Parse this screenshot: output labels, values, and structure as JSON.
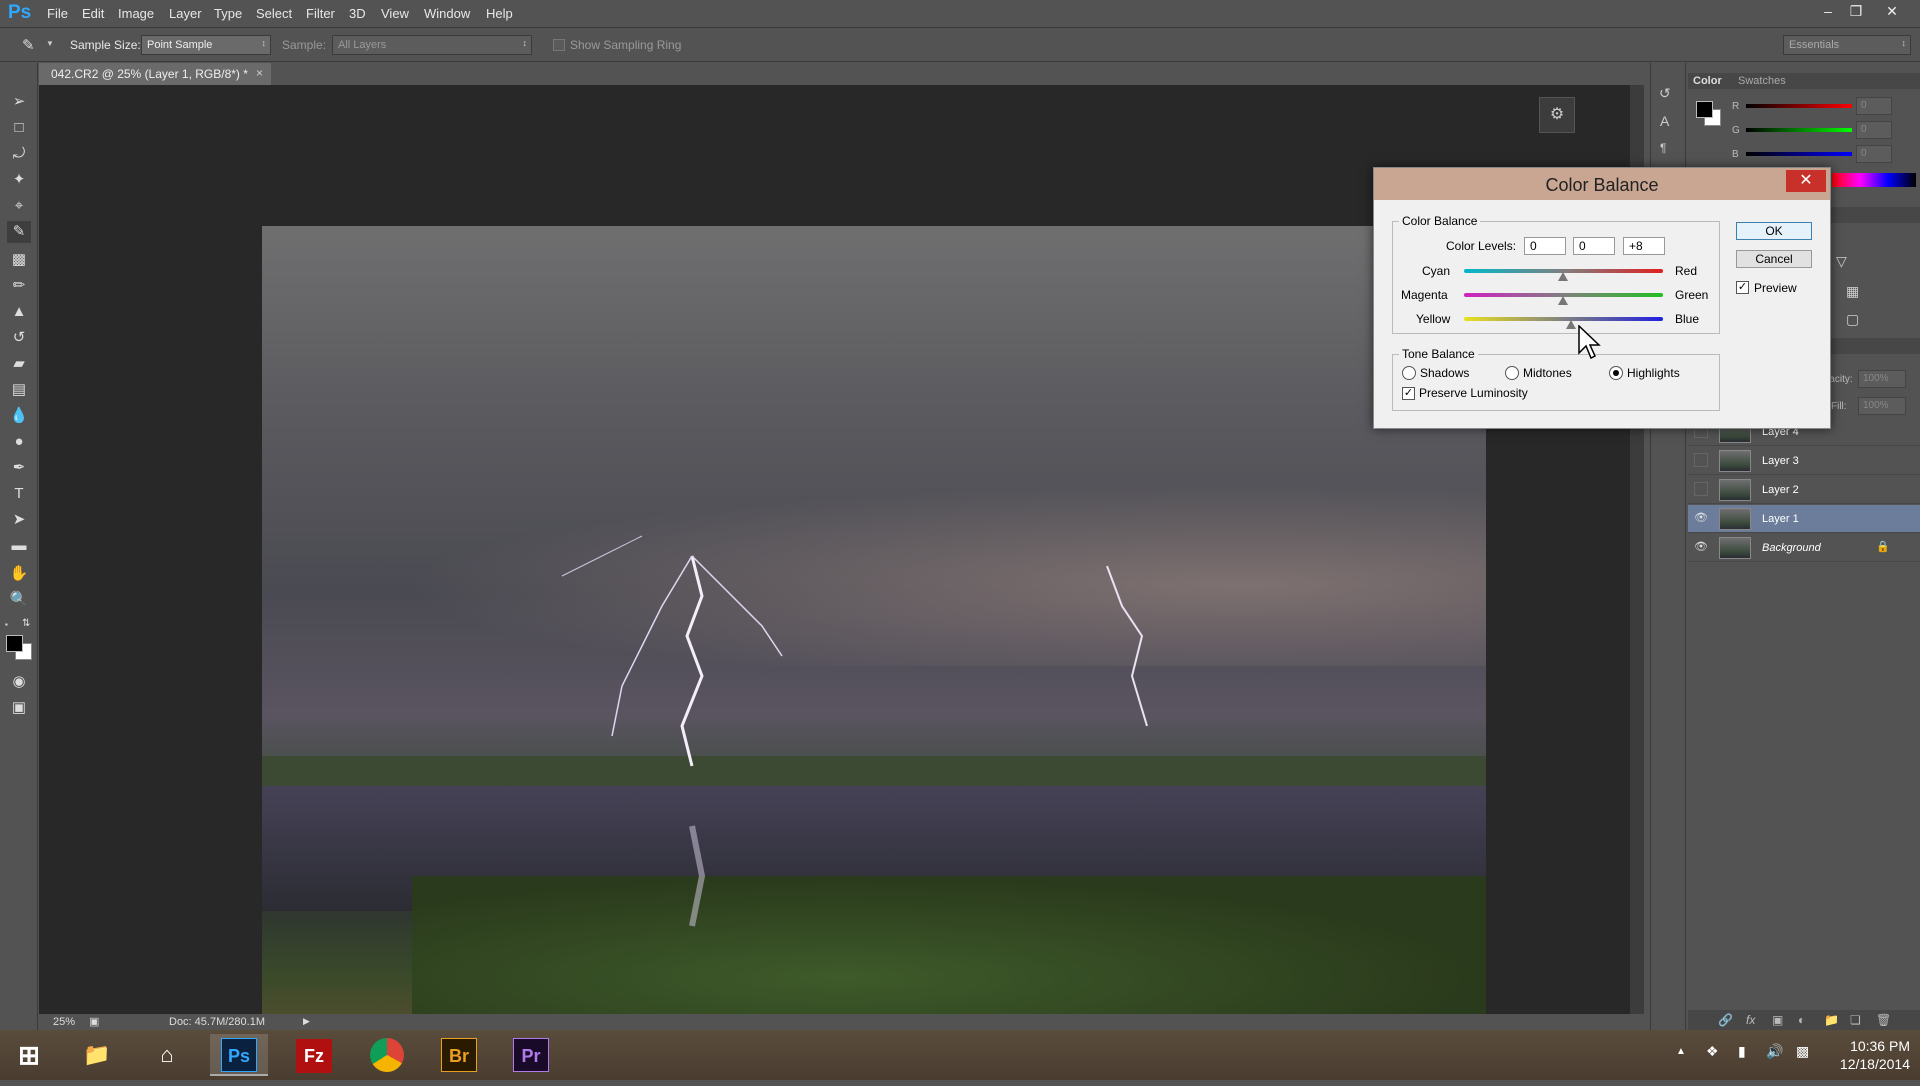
{
  "app": {
    "logo": "Ps"
  },
  "menu": [
    "File",
    "Edit",
    "Image",
    "Layer",
    "Type",
    "Select",
    "Filter",
    "3D",
    "View",
    "Window",
    "Help"
  ],
  "options": {
    "sample_size_label": "Sample Size:",
    "sample_size_value": "Point Sample",
    "sample_label": "Sample:",
    "sample_value": "All Layers",
    "sampling_ring_label": "Show Sampling Ring",
    "workspace": "Essentials"
  },
  "document": {
    "tab_title": "042.CR2 @ 25% (Layer 1, RGB/8*) *",
    "zoom": "25%",
    "doc_size": "Doc: 45.7M/280.1M"
  },
  "color_panel": {
    "tabs": [
      "Color",
      "Swatches"
    ],
    "r_label": "R",
    "g_label": "G",
    "b_label": "B",
    "r": "0",
    "g": "0",
    "b": "0"
  },
  "layers_panel": {
    "opacity_label": "Opacity:",
    "opacity": "100%",
    "fill_label": "Fill:",
    "fill": "100%",
    "layers": [
      {
        "name": "Layer 4",
        "visible": false,
        "selected": false
      },
      {
        "name": "Layer 3",
        "visible": false,
        "selected": false
      },
      {
        "name": "Layer 2",
        "visible": false,
        "selected": false
      },
      {
        "name": "Layer 1",
        "visible": true,
        "selected": true
      },
      {
        "name": "Background",
        "visible": true,
        "selected": false,
        "locked": true
      }
    ]
  },
  "dialog": {
    "title": "Color Balance",
    "color_balance_group": "Color Balance",
    "color_levels_label": "Color Levels:",
    "levels": [
      "0",
      "0",
      "+8"
    ],
    "sliders": [
      {
        "left": "Cyan",
        "right": "Red",
        "value": 0
      },
      {
        "left": "Magenta",
        "right": "Green",
        "value": 0
      },
      {
        "left": "Yellow",
        "right": "Blue",
        "value": 8
      }
    ],
    "tone_balance_group": "Tone Balance",
    "tones": [
      "Shadows",
      "Midtones",
      "Highlights"
    ],
    "selected_tone": "Highlights",
    "preserve_luminosity": "Preserve Luminosity",
    "ok": "OK",
    "cancel": "Cancel",
    "preview": "Preview"
  },
  "taskbar": {
    "apps": [
      {
        "name": "windows-start-icon",
        "label": ""
      },
      {
        "name": "file-explorer-icon",
        "label": ""
      },
      {
        "name": "home-icon",
        "label": ""
      },
      {
        "name": "photoshop-icon",
        "label": "Ps"
      },
      {
        "name": "filezilla-icon",
        "label": "Fz"
      },
      {
        "name": "chrome-icon",
        "label": ""
      },
      {
        "name": "bridge-icon",
        "label": "Br"
      },
      {
        "name": "premiere-icon",
        "label": "Pr"
      }
    ],
    "time": "10:36 PM",
    "date": "12/18/2014"
  },
  "colors": {
    "accent_layer_selected": "#6b7d9a",
    "dialog_close": "#c7312a",
    "ps_blue": "#31a8ff"
  }
}
